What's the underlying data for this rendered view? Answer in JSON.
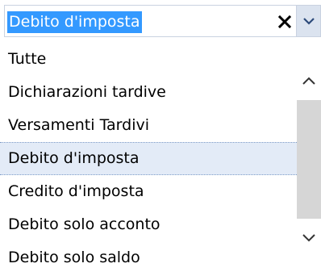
{
  "combo": {
    "value": "Debito d'imposta",
    "clear_icon": "close-icon",
    "dropdown_icon": "chevron-down-icon"
  },
  "list": {
    "items": [
      {
        "label": "Tutte"
      },
      {
        "label": "Dichiarazioni tardive"
      },
      {
        "label": "Versamenti Tardivi"
      },
      {
        "label": "Debito d'imposta",
        "selected": true
      },
      {
        "label": "Credito d'imposta"
      },
      {
        "label": "Debito solo acconto"
      },
      {
        "label": "Debito solo saldo"
      }
    ]
  },
  "scrollbar": {
    "up_icon": "chevron-up-icon",
    "down_icon": "chevron-down-icon"
  },
  "colors": {
    "selection_highlight": "#3399ff",
    "selected_row_bg": "#e3ebf7",
    "dropdown_button_bg": "#dbe3ef",
    "scroll_thumb": "#d6d6d6"
  }
}
